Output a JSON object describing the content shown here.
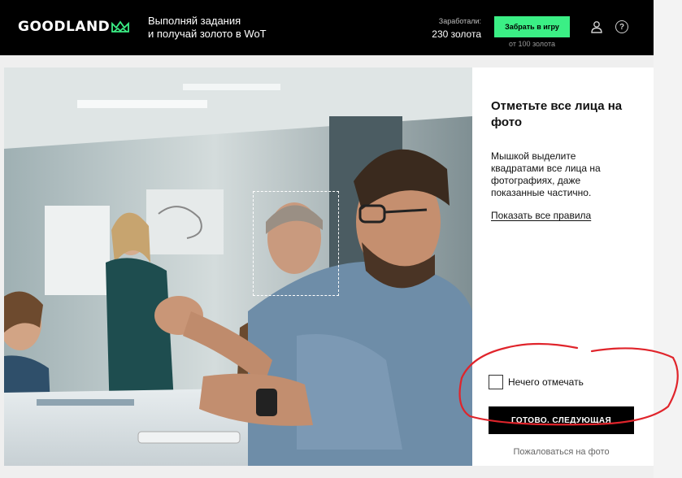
{
  "header": {
    "logo_text": "GOODLAND",
    "logo_icon": "crown-icon",
    "tagline_line1": "Выполняй задания",
    "tagline_line2": "и получай золото в WoT",
    "earned_label": "Заработали:",
    "earned_value": "230 золота",
    "claim_button": "Забрать в игру",
    "claim_note": "от 100 золота",
    "user_icon": "user-icon",
    "help_icon": "help-icon",
    "help_glyph": "?"
  },
  "task": {
    "title": "Отметьте все лица на фото",
    "description": "Мышкой выделите квадратами все лица на фотографиях, даже показанные частично.",
    "rules_link": "Показать все правила",
    "nothing_label": "Нечего отмечать",
    "nothing_checked": false,
    "done_button": "ГОТОВО. СЛЕДУЮЩАЯ",
    "report_link": "Пожаловаться на фото"
  },
  "colors": {
    "header_bg": "#000000",
    "accent_green": "#3bef85",
    "annotation_red": "#e0242b",
    "done_button_bg": "#000000"
  }
}
